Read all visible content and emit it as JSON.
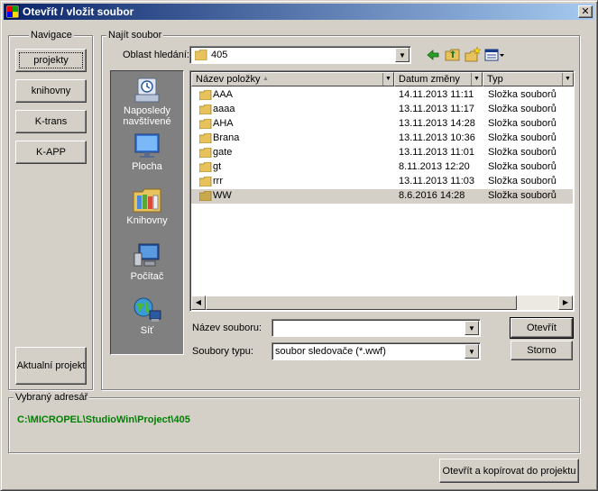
{
  "window": {
    "title": "Otevřít / vložit soubor",
    "close_glyph": "✕"
  },
  "nav": {
    "group_label": "Navigace",
    "buttons": [
      "projekty",
      "knihovny",
      "K-trans",
      "K-APP"
    ],
    "current_project_label": "Aktualní projekt"
  },
  "find": {
    "group_label": "Najít soubor",
    "look_in_label": "Oblast hledání:",
    "look_in_value": "405",
    "toolbar_icons": [
      "back-arrow-icon",
      "up-folder-icon",
      "new-folder-icon",
      "view-menu-icon"
    ]
  },
  "places": [
    {
      "label": "Naposledy navštívené",
      "icon": "recent-places-icon"
    },
    {
      "label": "Plocha",
      "icon": "desktop-icon"
    },
    {
      "label": "Knihovny",
      "icon": "libraries-icon"
    },
    {
      "label": "Počítač",
      "icon": "computer-icon"
    },
    {
      "label": "Síť",
      "icon": "network-icon"
    }
  ],
  "list": {
    "columns": [
      "Název položky",
      "Datum změny",
      "Typ"
    ],
    "rows": [
      {
        "name": "AAA",
        "date": "14.11.2013 11:11",
        "type": "Složka souborů",
        "selected": false
      },
      {
        "name": "aaaa",
        "date": "13.11.2013 11:17",
        "type": "Složka souborů",
        "selected": false
      },
      {
        "name": "AHA",
        "date": "13.11.2013 14:28",
        "type": "Složka souborů",
        "selected": false
      },
      {
        "name": "Brana",
        "date": "13.11.2013 10:36",
        "type": "Složka souborů",
        "selected": false
      },
      {
        "name": "gate",
        "date": "13.11.2013 11:01",
        "type": "Složka souborů",
        "selected": false
      },
      {
        "name": "gt",
        "date": "8.11.2013 12:20",
        "type": "Složka souborů",
        "selected": false
      },
      {
        "name": "rrr",
        "date": "13.11.2013 11:03",
        "type": "Složka souborů",
        "selected": false
      },
      {
        "name": "WW",
        "date": "8.6.2016 14:28",
        "type": "Složka souborů",
        "selected": true
      }
    ]
  },
  "file_name": {
    "label": "Název souboru:",
    "value": ""
  },
  "file_type": {
    "label": "Soubory typu:",
    "value": "soubor sledovače (*.wwf)"
  },
  "buttons": {
    "open": "Otevřít",
    "cancel": "Storno",
    "open_copy": "Otevřít a kopírovat do projektu"
  },
  "selected_address": {
    "group_label": "Vybraný adresář",
    "path": "C:\\MICROPEL\\StudioWin\\Project\\405"
  },
  "colors": {
    "title_start": "#0a246a",
    "title_end": "#a6caf0",
    "dialog_bg": "#d4d0c8",
    "path_text": "#008000",
    "places_bg": "#808080"
  }
}
